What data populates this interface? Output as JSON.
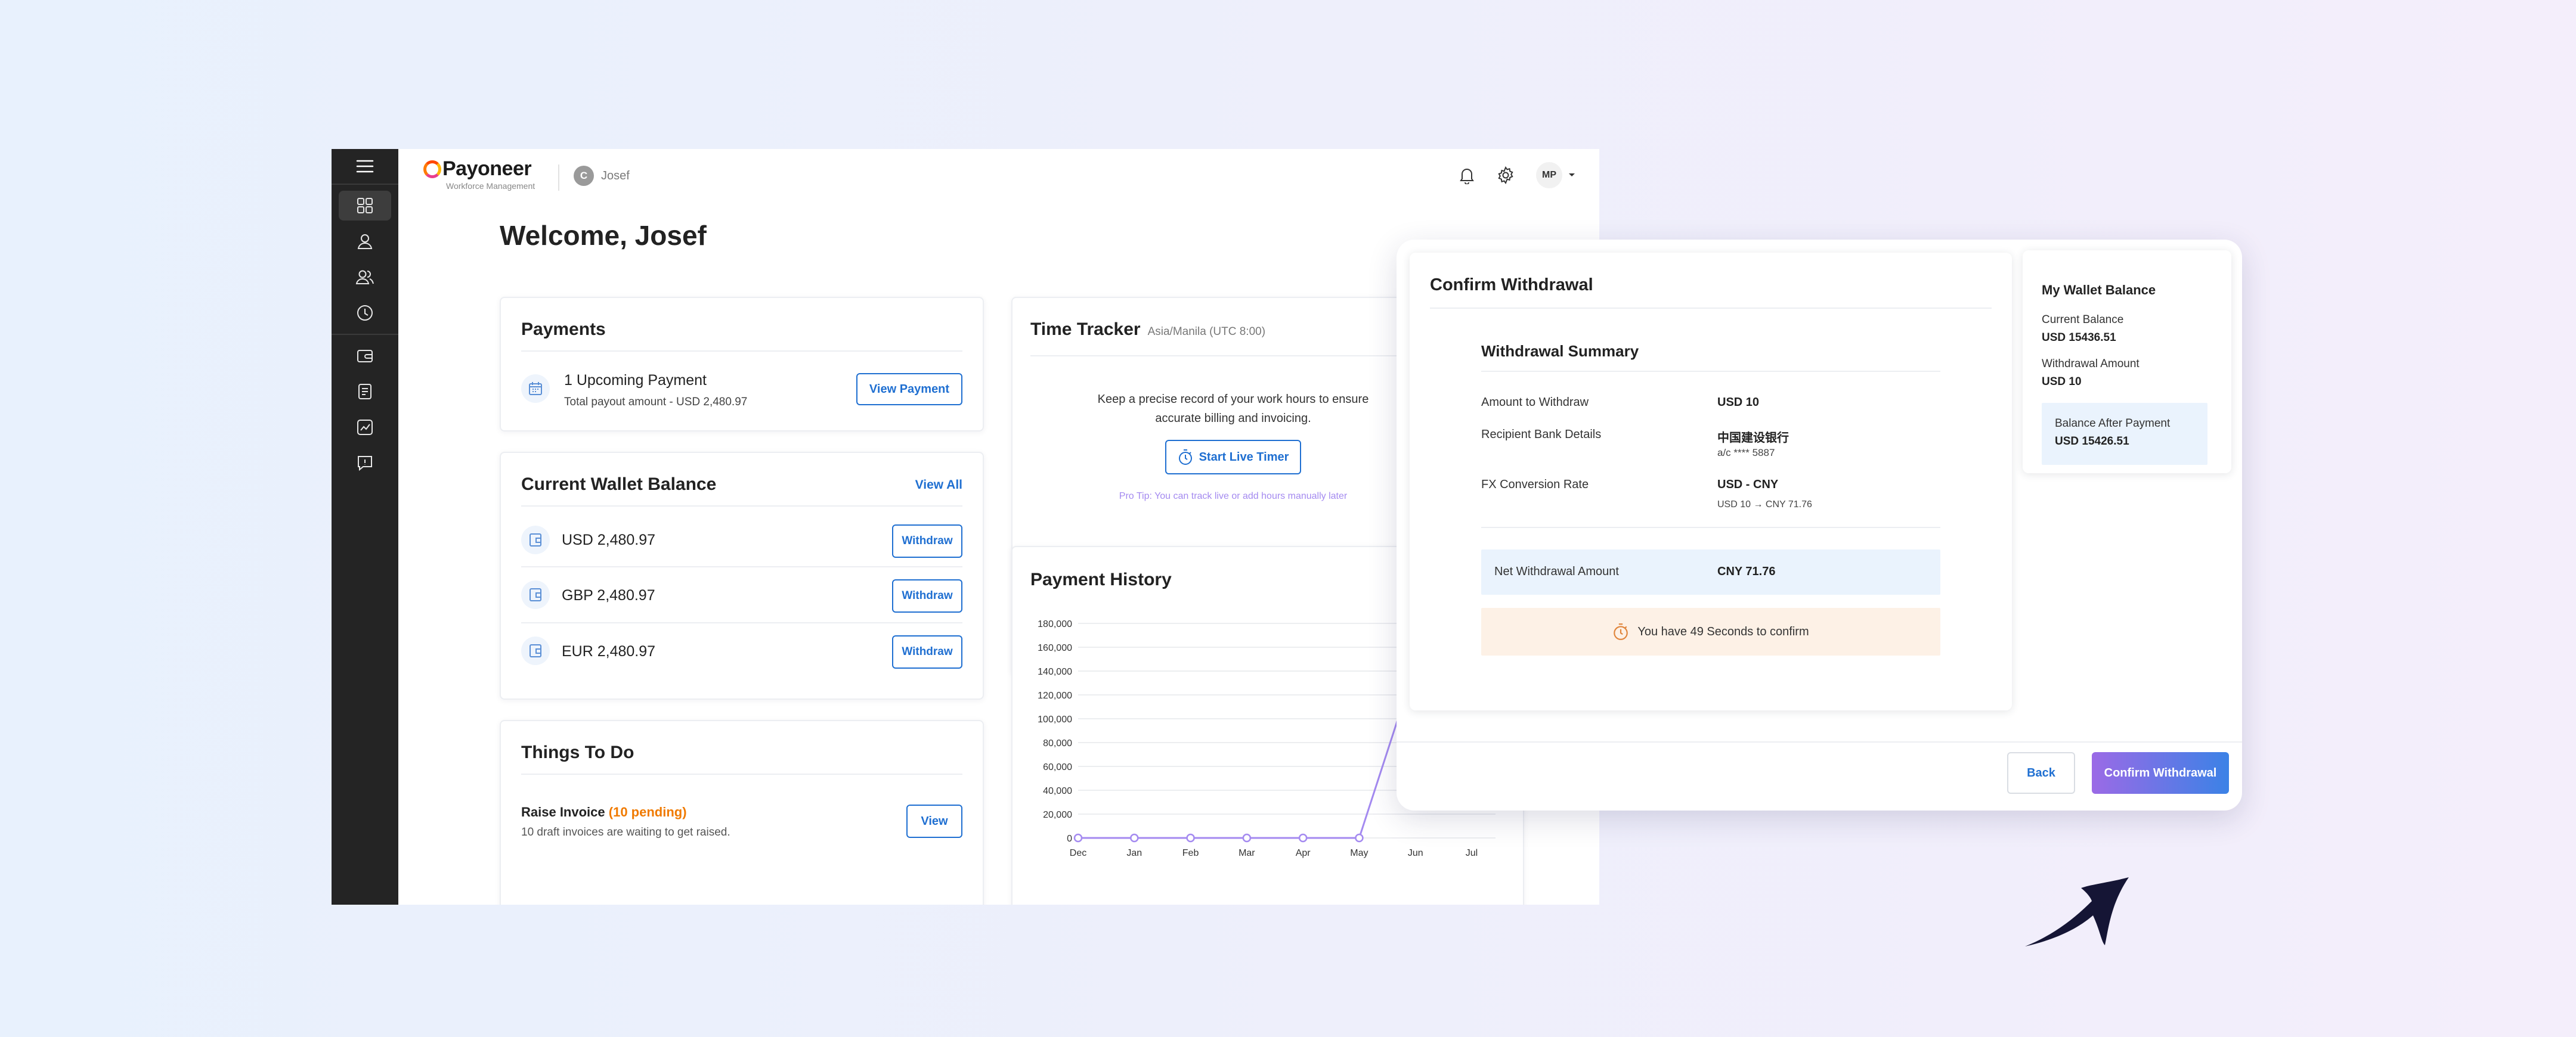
{
  "brand": {
    "name": "Payoneer",
    "tagline": "Workforce Management"
  },
  "company": {
    "initial": "C",
    "name": "Josef"
  },
  "user": {
    "initials": "MP"
  },
  "sidebar": {
    "items": [
      {
        "icon": "grid-icon",
        "active": true
      },
      {
        "icon": "user-icon"
      },
      {
        "icon": "users-icon"
      },
      {
        "icon": "clock-icon"
      },
      {
        "icon": "wallet-icon"
      },
      {
        "icon": "invoice-icon"
      },
      {
        "icon": "chart-icon"
      },
      {
        "icon": "message-icon"
      }
    ]
  },
  "welcome": "Welcome, Josef",
  "payments": {
    "title": "Payments",
    "upcoming": "1 Upcoming Payment",
    "total": "Total payout amount - USD 2,480.97",
    "button": "View Payment"
  },
  "wallet": {
    "title": "Current Wallet Balance",
    "view_all": "View All",
    "items": [
      {
        "amount": "USD 2,480.97",
        "button": "Withdraw"
      },
      {
        "amount": "GBP 2,480.97",
        "button": "Withdraw"
      },
      {
        "amount": "EUR 2,480.97",
        "button": "Withdraw"
      }
    ]
  },
  "todo": {
    "title": "Things To Do",
    "task": "Raise Invoice",
    "pending": "(10 pending)",
    "desc": "10 draft invoices are waiting to get raised.",
    "button": "View"
  },
  "tracker": {
    "title": "Time Tracker",
    "timezone": "Asia/Manila (UTC 8:00)",
    "desc_line1": "Keep a precise record of your work hours to ensure",
    "desc_line2": "accurate billing and invoicing.",
    "button": "Start Live Timer",
    "tip": "Pro Tip: You can track live or add hours manually later"
  },
  "history": {
    "title": "Payment History"
  },
  "chart_data": {
    "type": "line",
    "title": "Payment History",
    "categories": [
      "Dec",
      "Jan",
      "Feb",
      "Mar",
      "Apr",
      "May",
      "Jun",
      "Jul"
    ],
    "series": [
      {
        "values": [
          0,
          0,
          0,
          0,
          0,
          0,
          145000,
          null
        ]
      }
    ],
    "yticks": [
      "0",
      "20,000",
      "40,000",
      "60,000",
      "80,000",
      "100,000",
      "120,000",
      "140,000",
      "160,000",
      "180,000"
    ],
    "ylim": [
      0,
      180000
    ],
    "grid": true,
    "color": "#a48af0"
  },
  "modal": {
    "title": "Confirm Withdrawal",
    "summary_title": "Withdrawal Summary",
    "rows": [
      {
        "label": "Amount to Withdraw",
        "value": "USD 10",
        "sub": ""
      },
      {
        "label": "Recipient Bank Details",
        "value": "中国建设银行",
        "sub": "a/c **** 5887"
      },
      {
        "label": "FX Conversion Rate",
        "value": "USD - CNY",
        "sub": "USD 10 → CNY 71.76"
      }
    ],
    "net_label": "Net Withdrawal Amount",
    "net_value": "CNY 71.76",
    "timer": "You have 49 Seconds to confirm",
    "back": "Back",
    "confirm": "Confirm Withdrawal"
  },
  "my_wallet": {
    "title": "My Wallet Balance",
    "current_label": "Current Balance",
    "current_value": "USD 15436.51",
    "withdraw_label": "Withdrawal Amount",
    "withdraw_value": "USD 10",
    "after_label": "Balance After Payment",
    "after_value": "USD 15426.51"
  },
  "colors": {
    "accent": "#1f6fd1",
    "sidebar": "#242424",
    "pending": "#f07a00",
    "tip": "#a48af0",
    "net_bg": "#eaf3fd",
    "timer_bg": "#fdf1e6",
    "confirm_gradient": [
      "#9b6ae6",
      "#3b82e6"
    ]
  }
}
